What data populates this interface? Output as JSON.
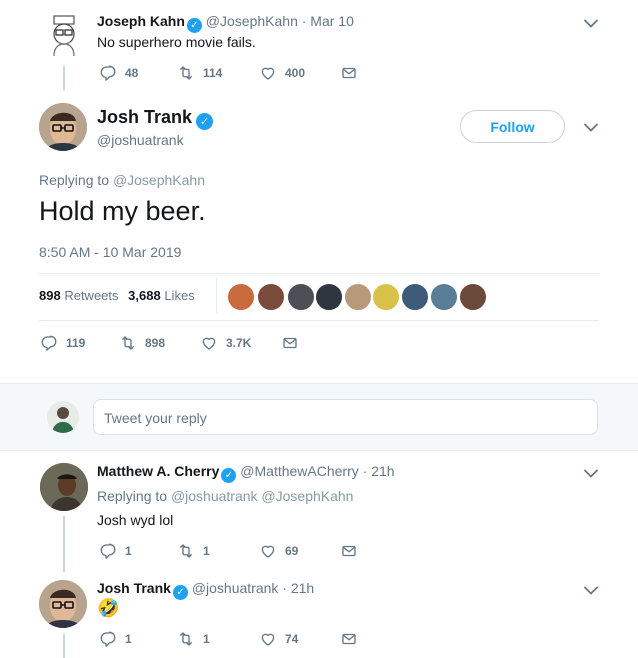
{
  "tweet_parent": {
    "name": "Joseph Kahn",
    "handle": "@JosephKahn",
    "time": "· Mar 10",
    "text": "No superhero movie fails.",
    "replies": "48",
    "retweets": "114",
    "likes": "400"
  },
  "main_tweet": {
    "name": "Josh Trank",
    "handle": "@joshuatrank",
    "follow_label": "Follow",
    "replying_prefix": "Replying to",
    "replying_to": "@JosephKahn",
    "text": "Hold my beer.",
    "timestamp": "8:50 AM - 10 Mar 2019",
    "retweet_count": "898",
    "retweet_label": "Retweets",
    "like_count": "3,688",
    "like_label": "Likes",
    "replies": "119",
    "retweets": "898",
    "likes": "3.7K"
  },
  "reply_box": {
    "placeholder": "Tweet your reply"
  },
  "reply1": {
    "name": "Matthew A. Cherry",
    "handle": "@MatthewACherry",
    "time": "· 21h",
    "replying_prefix": "Replying to",
    "replying_to": "@joshuatrank @JosephKahn",
    "text": "Josh wyd lol",
    "replies": "1",
    "retweets": "1",
    "likes": "69"
  },
  "reply2": {
    "name": "Josh Trank",
    "handle": "@joshuatrank",
    "time": "· 21h",
    "text": "🤣",
    "replies": "1",
    "retweets": "1",
    "likes": "74"
  },
  "icons": {
    "reply": "reply-icon",
    "retweet": "retweet-icon",
    "like": "heart-icon",
    "dm": "envelope-icon",
    "chevron": "chevron-down-icon",
    "verified": "verified-badge-icon"
  },
  "colors": {
    "accent": "#1da1f2",
    "text_secondary": "#657786",
    "divider": "#e6ecf0",
    "reply_bar_bg": "#f5f8fa"
  }
}
